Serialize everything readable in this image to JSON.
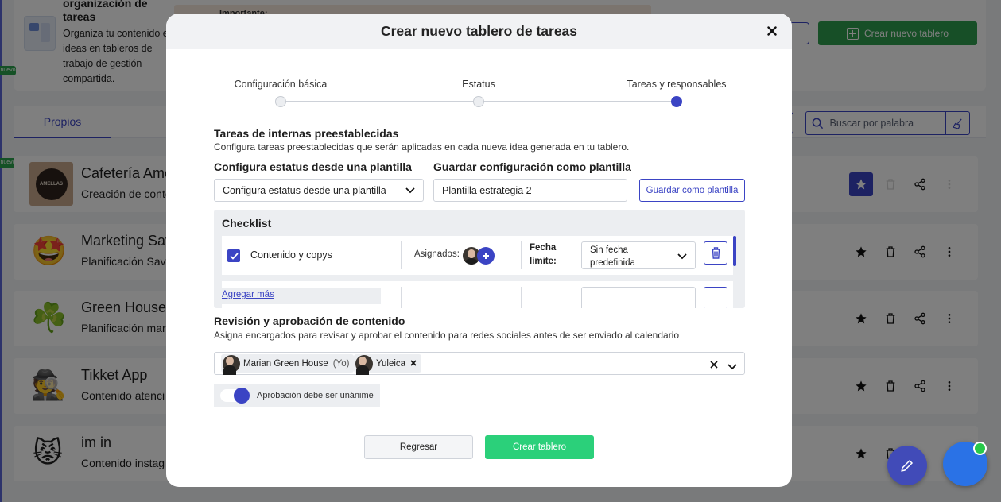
{
  "background": {
    "info_card": {
      "title": "organización de tareas",
      "description": "Organiza tu contenido e ideas en tableros de trabajo de gestión compartida.",
      "important_label": "Importante:",
      "new_badge": "nuevo",
      "create_board_label": "Crear nuevo tablero"
    },
    "tabs": [
      {
        "label": "Propios"
      }
    ],
    "search": {
      "placeholder": "Buscar por palabra"
    },
    "boards": [
      {
        "name": "Cafetería Ame",
        "desc": "Creación de conte",
        "logo_text": "AMELLAS"
      },
      {
        "name": "Marketing Sav",
        "desc": "Planificación Sav",
        "emoji": "🤩"
      },
      {
        "name": "Green House",
        "desc": "Planificación mar",
        "emoji": "☘️"
      },
      {
        "name": "Tikket App",
        "desc": "Contenido atenci",
        "emoji": "🕵️"
      },
      {
        "name": "im in",
        "desc": "Contenido instag",
        "emoji": "😾"
      }
    ]
  },
  "modal": {
    "title": "Crear nuevo tablero de tareas",
    "steps": [
      {
        "label": "Configuración básica",
        "active": false
      },
      {
        "label": "Estatus",
        "active": false
      },
      {
        "label": "Tareas y responsables",
        "active": true
      }
    ],
    "preset_tasks": {
      "title": "Tareas de internas preestablecidas",
      "description": "Configura tareas preestablecidas que serán aplicadas en cada nueva idea generada en tu tablero."
    },
    "status_template": {
      "title": "Configura estatus desde una plantilla",
      "selected": "Configura estatus desde una plantilla"
    },
    "save_template": {
      "title": "Guardar configuración como plantilla",
      "value": "Plantilla estrategia 2",
      "button_label": "Guardar como plantilla"
    },
    "checklist": {
      "title": "Checklist",
      "tasks": [
        {
          "name": "Contenido y copys",
          "checked": true,
          "assigned_label": "Asignados:",
          "deadline_label": "Fecha límite:",
          "deadline_value": "Sin fecha predefinida"
        }
      ],
      "add_more_label": "Agregar más"
    },
    "review": {
      "title": "Revisión y aprobación de contenido",
      "description": "Asigna encargados para revisar y aprobar el contenido para redes sociales antes de ser enviado al calendario",
      "reviewers": [
        {
          "name": "Marian Green House",
          "suffix": "(Yo)"
        },
        {
          "name": "Yuleica"
        }
      ]
    },
    "unanimous_toggle": {
      "label": "Aprobación debe ser unánime",
      "on": true
    },
    "buttons": {
      "back": "Regresar",
      "create": "Crear tablero"
    }
  },
  "colors": {
    "accent": "#3b44c4",
    "success": "#2bd07a",
    "brand_green": "#2e9e4f"
  }
}
